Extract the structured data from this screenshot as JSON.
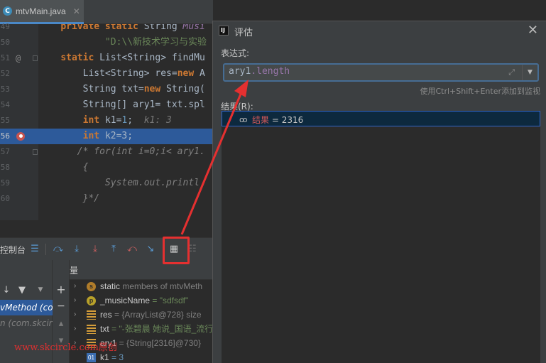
{
  "editor": {
    "tab_label": "mtvMain.java",
    "line_numbers": [
      "49",
      "50",
      "51",
      "52",
      "53",
      "54",
      "55",
      "56",
      "57",
      "58",
      "59",
      "60"
    ],
    "lines": [
      {
        "parts": [
          {
            "t": "    ",
            "c": ""
          },
          {
            "t": "private static ",
            "c": "kw"
          },
          {
            "t": "String ",
            "c": ""
          },
          {
            "t": "Musi",
            "c": "fld"
          }
        ]
      },
      {
        "parts": [
          {
            "t": "            ",
            "c": ""
          },
          {
            "t": "\"D:\\\\新技术学习与实验",
            "c": "str"
          }
        ]
      },
      {
        "parts": [
          {
            "t": "    ",
            "c": ""
          },
          {
            "t": "static ",
            "c": "kw"
          },
          {
            "t": "List<String> findMu",
            "c": ""
          }
        ]
      },
      {
        "parts": [
          {
            "t": "        ",
            "c": ""
          },
          {
            "t": "List<String> res=",
            "c": ""
          },
          {
            "t": "new ",
            "c": "kw"
          },
          {
            "t": "A",
            "c": ""
          }
        ]
      },
      {
        "parts": [
          {
            "t": "        ",
            "c": ""
          },
          {
            "t": "String txt=",
            "c": ""
          },
          {
            "t": "new ",
            "c": "kw"
          },
          {
            "t": "String(",
            "c": ""
          }
        ]
      },
      {
        "parts": [
          {
            "t": "        ",
            "c": ""
          },
          {
            "t": "String[] ary1= txt.spl",
            "c": ""
          }
        ]
      },
      {
        "parts": [
          {
            "t": "        ",
            "c": ""
          },
          {
            "t": "int ",
            "c": "kw"
          },
          {
            "t": "k1=",
            "c": ""
          },
          {
            "t": "1",
            "c": "numlit"
          },
          {
            "t": ";  ",
            "c": ""
          },
          {
            "t": "k1: 3",
            "c": "inl"
          }
        ]
      },
      {
        "parts": [
          {
            "t": "        ",
            "c": ""
          },
          {
            "t": "int ",
            "c": "kw"
          },
          {
            "t": "k2=3;",
            "c": ""
          }
        ]
      },
      {
        "parts": [
          {
            "t": "       ",
            "c": ""
          },
          {
            "t": "/* for(int i=0;i< ary1.",
            "c": "cmt"
          }
        ]
      },
      {
        "parts": [
          {
            "t": "        ",
            "c": ""
          },
          {
            "t": "{",
            "c": "cmt"
          }
        ]
      },
      {
        "parts": [
          {
            "t": "            ",
            "c": ""
          },
          {
            "t": "System.out.printl",
            "c": "cmt"
          }
        ]
      },
      {
        "parts": [
          {
            "t": "        ",
            "c": ""
          },
          {
            "t": "}*/",
            "c": "cmt"
          }
        ]
      }
    ],
    "current_line_index": 7,
    "breakpoint_line_index": 7
  },
  "debug": {
    "console_tab_label": "控制台",
    "variables_title": "变量",
    "frames": [
      {
        "label": "vMethod (co",
        "selected": true
      },
      {
        "label": "n (com.skcir",
        "selected": false
      }
    ],
    "variables": [
      {
        "arrow": "›",
        "icon": "s",
        "icon_kind": "static",
        "name": "static",
        "value": " members of mtvMeth",
        "value_style": "gray"
      },
      {
        "arrow": "›",
        "icon": "p",
        "icon_kind": "param",
        "name": "_musicName",
        "value": " = \"sdfsdf\"",
        "value_style": "str"
      },
      {
        "arrow": "›",
        "icon": "",
        "icon_kind": "field",
        "name": "res",
        "value": " = {ArrayList@728}  size",
        "value_style": "gray"
      },
      {
        "arrow": "›",
        "icon": "",
        "icon_kind": "field",
        "name": "txt",
        "value": " = \"-张碧晨 她说_国语_流行",
        "value_style": "str"
      },
      {
        "arrow": "›",
        "icon": "",
        "icon_kind": "field",
        "name": "ary1",
        "value": " = {String[2316]@730}",
        "value_style": "gray"
      },
      {
        "arrow": "",
        "icon": "01",
        "icon_kind": "int",
        "name": "k1",
        "value": " = 3",
        "value_style": "num"
      }
    ]
  },
  "dialog": {
    "title": "评估",
    "close_glyph": "✕",
    "expression_label": "表达式:",
    "expression_var": "ary1",
    "expression_field": ".length",
    "hint": "使用Ctrl+Shift+Enter添加到监视",
    "result_label": "结果(R):",
    "result_name": "结果",
    "result_value": " = 2316"
  },
  "watermark": "www.skcircle.com原创",
  "colors": {
    "annotation": "#e53030",
    "selection": "#2d5a9a",
    "result_selection": "#0d293e"
  }
}
